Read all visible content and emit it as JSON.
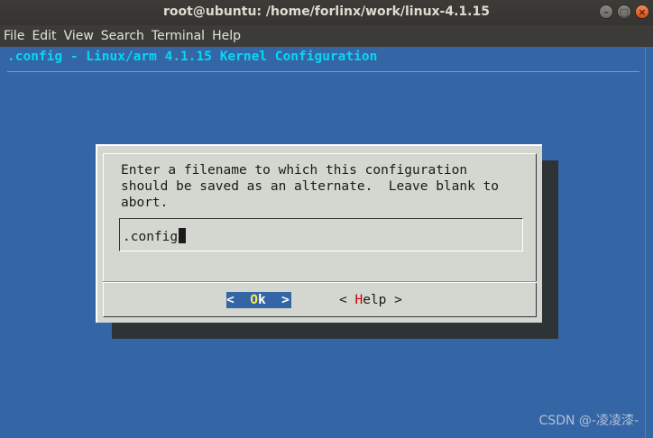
{
  "window": {
    "title": "root@ubuntu: /home/forlinx/work/linux-4.1.15",
    "buttons": [
      "–",
      "□",
      "×"
    ]
  },
  "menubar": {
    "items": [
      "File",
      "Edit",
      "View",
      "Search",
      "Terminal",
      "Help"
    ]
  },
  "terminal": {
    "backtitle": ".config - Linux/arm 4.1.15 Kernel Configuration",
    "dialog": {
      "prompt": "Enter a filename to which this configuration\nshould be saved as an alternate.  Leave blank to\nabort.",
      "input_value": ".config",
      "ok_button": {
        "left": "<  ",
        "hot": "O",
        "rest": "k",
        "right": "  >"
      },
      "help_button": {
        "left": "< ",
        "hot": "H",
        "rest": "elp",
        "right": " >"
      }
    }
  },
  "watermark": "CSDN @-凌凌漆-",
  "colors": {
    "terminal_bg": "#3465a4",
    "backtitle": "#06d7f5",
    "dialog_bg": "#d3d7cf",
    "shadow": "#2e3436",
    "ok_hotkey": "#fce94f",
    "help_hotkey": "#cc0000"
  }
}
